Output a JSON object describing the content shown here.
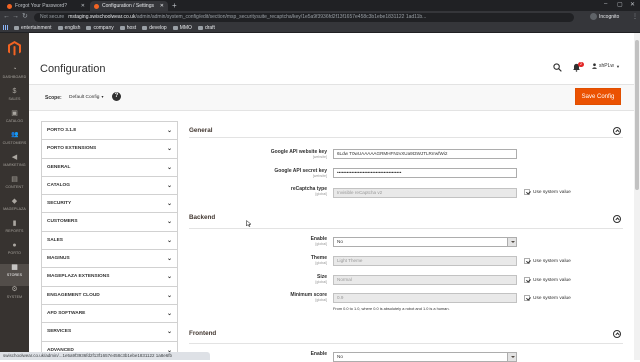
{
  "browser": {
    "tabs": [
      {
        "title": "Forgot Your Password?",
        "color": "#f26322",
        "active": false
      },
      {
        "title": "Configuration / Settings",
        "color": "#f26322",
        "active": true
      }
    ],
    "new_tab": "+",
    "security": "Not secure",
    "url_host": "mstaging.swischoolwear.co.uk",
    "url_path": "/admin/admin/system_config/edit/section/msp_securitysuite_recaptcha/key/1e5a9f3936fd2f13f1657e458c3b1ebe1831122 1ad11b...",
    "profile": "Incognito",
    "bookmarks": [
      "entertainment",
      "english",
      "company",
      "host",
      "develop",
      "MMO",
      "draft"
    ]
  },
  "sidebar": {
    "items": [
      {
        "label": "DASHBOARD",
        "icon": "dashboard-icon",
        "glyph": "◔"
      },
      {
        "label": "SALES",
        "icon": "dollar-icon",
        "glyph": "$"
      },
      {
        "label": "CATALOG",
        "icon": "cube-icon",
        "glyph": "▣"
      },
      {
        "label": "CUSTOMERS",
        "icon": "people-icon",
        "glyph": "👥"
      },
      {
        "label": "MARKETING",
        "icon": "megaphone-icon",
        "glyph": "◀"
      },
      {
        "label": "CONTENT",
        "icon": "layout-icon",
        "glyph": "▤"
      },
      {
        "label": "MAGEPLAZA",
        "icon": "mageplaza-icon",
        "glyph": "◆"
      },
      {
        "label": "REPORTS",
        "icon": "bar-chart-icon",
        "glyph": "▮"
      },
      {
        "label": "PORTO",
        "icon": "porto-icon",
        "glyph": "●"
      },
      {
        "label": "STORES",
        "icon": "store-icon",
        "glyph": "▦"
      },
      {
        "label": "SYSTEM",
        "icon": "gear-icon",
        "glyph": "⚙"
      }
    ]
  },
  "header": {
    "title": "Configuration",
    "notifications": "2",
    "user": "shPLw"
  },
  "toolbar": {
    "scope_label": "Scope:",
    "scope_value": "Default Config",
    "help": "?",
    "save_label": "Save Config"
  },
  "config_tabs": [
    "PORTO 3.1.8",
    "PORTO EXTENSIONS",
    "GENERAL",
    "CATALOG",
    "SECURITY",
    "CUSTOMERS",
    "SALES",
    "MAGINUS",
    "MAGEPLAZA EXTENSIONS",
    "ENGAGEMENT CLOUD",
    "AFD SOFTWARE",
    "SERVICES",
    "ADVANCED"
  ],
  "sections": {
    "general": {
      "title": "General",
      "fields": {
        "website_key": {
          "label": "Google API website key",
          "scope": "[website]",
          "value": "6Ldw T0wUAAAAAGRMHFNzvXUa9t3WJTLRrrwfWi2"
        },
        "secret_key": {
          "label": "Google API secret key",
          "scope": "[website]",
          "value": "••••••••••••••••••••••••••••••••••••••••"
        },
        "recaptcha_type": {
          "label": "reCaptcha type",
          "scope": "[global]",
          "value": "Invisible reCaptcha v2",
          "system": "Use system value"
        }
      }
    },
    "backend": {
      "title": "Backend",
      "fields": {
        "enable": {
          "label": "Enable",
          "scope": "[global]",
          "value": "No"
        },
        "theme": {
          "label": "Theme",
          "scope": "[global]",
          "value": "Light Theme",
          "system": "Use system value"
        },
        "size": {
          "label": "Size",
          "scope": "[global]",
          "value": "Normal",
          "system": "Use system value"
        },
        "min_score": {
          "label": "Minimum score",
          "scope": "[global]",
          "value": "0.9",
          "system": "Use system value",
          "note": "From 0.0 to 1.0, where 0.0 is absolutely a robot and 1.0 is a human."
        }
      }
    },
    "frontend": {
      "title": "Frontend",
      "fields": {
        "enable": {
          "label": "Enable",
          "scope": "[global]",
          "value": "No"
        }
      }
    }
  },
  "status_url": "swischoolwear.co.uk/admin/...1e5a9f3936fd2f13f1657e458c3b1ebe1831122 1a8e6fb"
}
